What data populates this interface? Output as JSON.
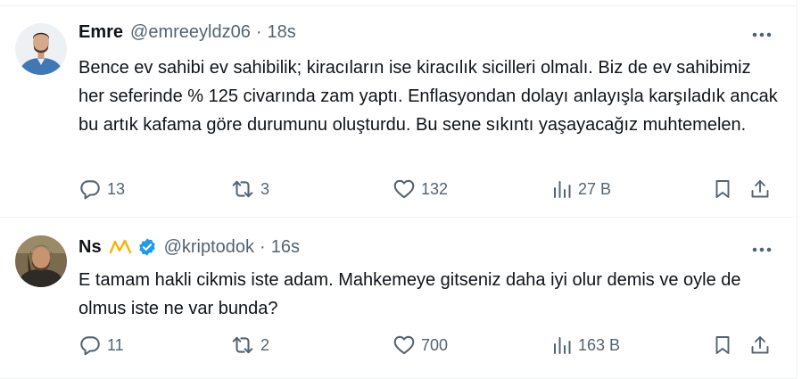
{
  "tweets": [
    {
      "author": {
        "name": "Emre",
        "handle": "@emreeyldz06",
        "time": "18s"
      },
      "text": "Bence ev sahibi ev sahibilik; kiracıların ise kiracılık sicilleri olmalı. Biz de ev sahibimiz her seferinde % 125 civarında zam yaptı. Enflasyondan dolayı anlayışla karşıladık ancak bu artık kafama göre durumunu oluşturdu. Bu sene sıkıntı yaşayacağız muhtemelen.",
      "stats": {
        "replies": "13",
        "reposts": "3",
        "likes": "132",
        "views": "27 B"
      }
    },
    {
      "author": {
        "name": "Ns",
        "handle": "@kriptodok",
        "time": "16s",
        "name_emoji": "〽",
        "verified": true
      },
      "text": "E tamam hakli cikmis iste adam. Mahkemeye gitseniz daha iyi olur demis ve oyle de olmus iste ne var bunda?",
      "stats": {
        "replies": "11",
        "reposts": "2",
        "likes": "700",
        "views": "163 B"
      }
    }
  ],
  "separator": "·",
  "colors": {
    "text": "#0f1419",
    "secondary": "#536471",
    "verified": "#1d9bf0",
    "border": "#eff3f4"
  },
  "icons": [
    "reply-icon",
    "repost-icon",
    "like-icon",
    "views-icon",
    "bookmark-icon",
    "share-icon",
    "more-icon",
    "verified-icon"
  ]
}
